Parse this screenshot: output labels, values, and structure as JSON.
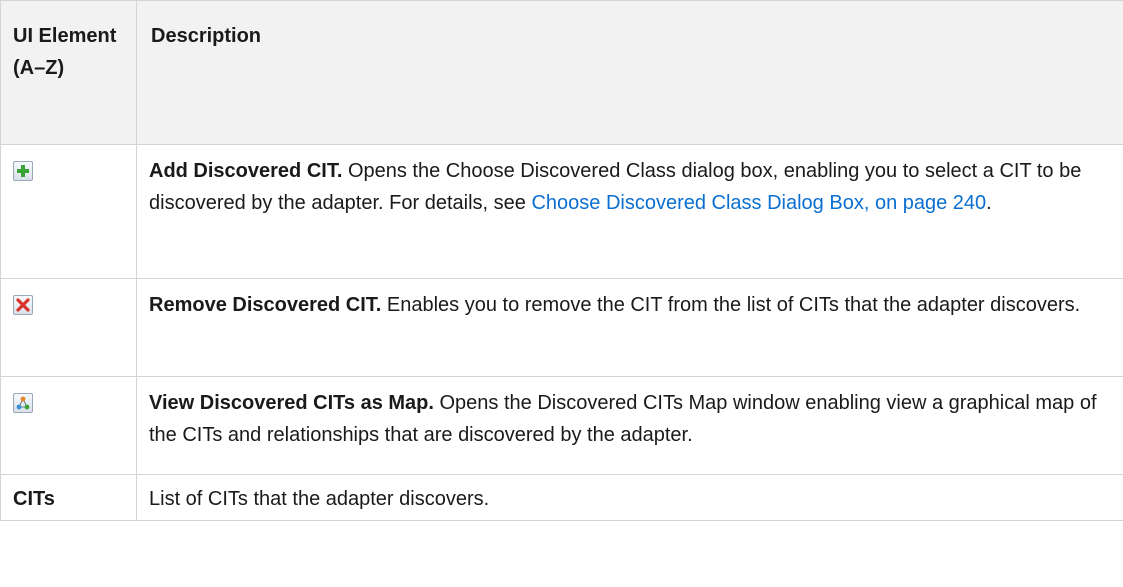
{
  "table": {
    "headers": {
      "element": "UI Element (A–Z)",
      "description": "Description"
    },
    "rows": [
      {
        "icon": "add-icon",
        "name": "Add Discovered CIT.",
        "text": "Opens the Choose Discovered Class dialog box, enabling you to select a CIT to be discovered by the adapter. For details, see ",
        "link": "Choose Discovered Class Dialog Box, on page 240",
        "after": "."
      },
      {
        "icon": "remove-icon",
        "name": "Remove Discovered CIT.",
        "text": "Enables you to remove the CIT from the list of CITs that the adapter discovers."
      },
      {
        "icon": "map-icon",
        "name": "View Discovered CITs as Map.",
        "text": "Opens the Discovered CITs Map window enabling view a graphical map of the CITs and relationships that are discovered by the adapter."
      },
      {
        "element": "CITs",
        "text": "List of CITs that the adapter discovers."
      }
    ]
  }
}
